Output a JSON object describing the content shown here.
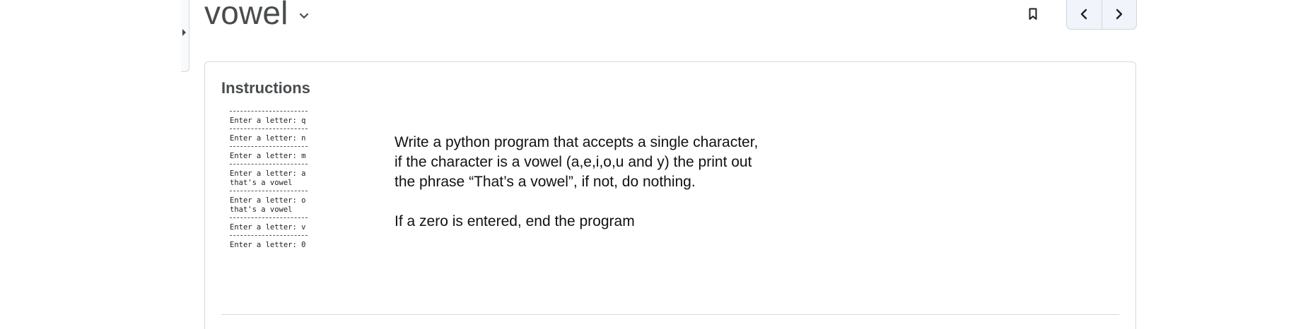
{
  "header": {
    "title": "vowel"
  },
  "icons": {
    "title_dropdown": "chevron-down-icon",
    "bookmark": "bookmark-icon",
    "previous": "chevron-left-icon",
    "next": "chevron-right-icon",
    "sidebar_toggle": "caret-right-icon"
  },
  "instructions": {
    "heading": "Instructions",
    "console": {
      "lines": [
        [
          "Enter a letter: q"
        ],
        [
          "Enter a letter: n"
        ],
        [
          "Enter a letter: m"
        ],
        [
          "Enter a letter: a",
          "that's a vowel"
        ],
        [
          "Enter a letter: o",
          "that's a vowel"
        ],
        [
          "Enter a letter: v"
        ],
        [
          "Enter a letter: 0"
        ]
      ]
    },
    "paragraph_1": "Write a python program that accepts a single character, if the character is a vowel (a,e,i,o,u and y) the print out the phrase “That’s a vowel”, if not, do nothing.",
    "paragraph_2": "If a zero is entered, end the program"
  },
  "colors": {
    "title_text": "#494c4e",
    "border": "#d3d9e3",
    "nav_background": "#f1f5fb"
  }
}
